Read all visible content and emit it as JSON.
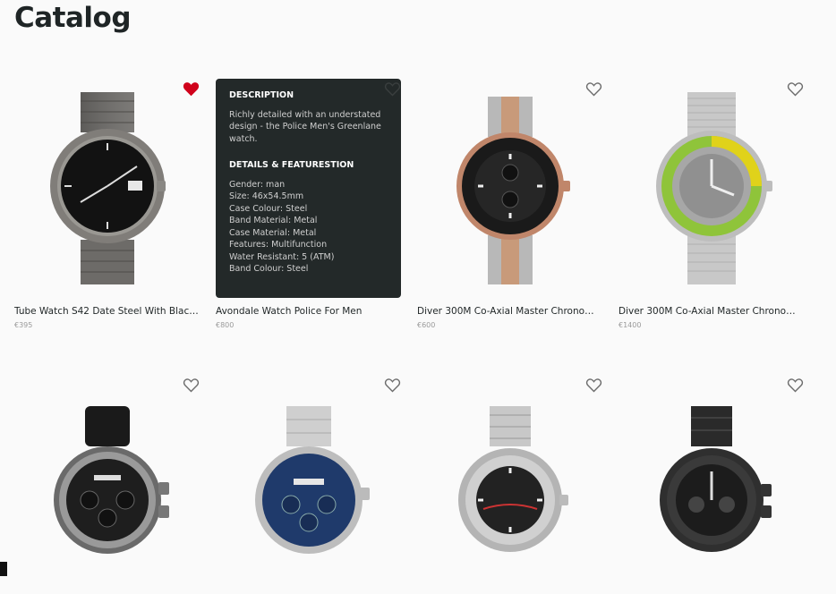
{
  "page": {
    "title": "Catalog"
  },
  "products": [
    {
      "name": "Tube Watch S42 Date Steel With Black ...",
      "price": "€395",
      "favorited": true,
      "style": "steel-black"
    },
    {
      "name": "Avondale Watch Police For Men",
      "price": "€800",
      "favorited": false,
      "style": "overlay"
    },
    {
      "name": "Diver 300M Co-Axial Master Chronomet...",
      "price": "€600",
      "favorited": false,
      "style": "rosegold-black"
    },
    {
      "name": "Diver 300M Co-Axial Master Chronomet...",
      "price": "€1400",
      "favorited": false,
      "style": "mesh-rainbow"
    },
    {
      "name": "",
      "price": "",
      "favorited": false,
      "style": "leather-black"
    },
    {
      "name": "",
      "price": "",
      "favorited": false,
      "style": "steel-blue"
    },
    {
      "name": "",
      "price": "",
      "favorited": false,
      "style": "steel-diver"
    },
    {
      "name": "",
      "price": "",
      "favorited": false,
      "style": "black-chrono"
    }
  ],
  "overlay": {
    "description_heading": "DESCRIPTION",
    "description_text": "Richly detailed with an understated design - the Police Men's Greenlane watch.",
    "details_heading": "DETAILS & FEATURESTION",
    "details": [
      "Gender: man",
      "Size: 46x54.5mm",
      "Case Colour: Steel",
      "Band Material: Metal",
      "Case Material: Metal",
      "Features: Multifunction",
      "Water Resistant: 5 (ATM)",
      "Band Colour: Steel"
    ]
  },
  "colors": {
    "heart_active": "#d0021b",
    "heart_outline": "#6b6b6b",
    "overlay_bg": "#232929"
  }
}
